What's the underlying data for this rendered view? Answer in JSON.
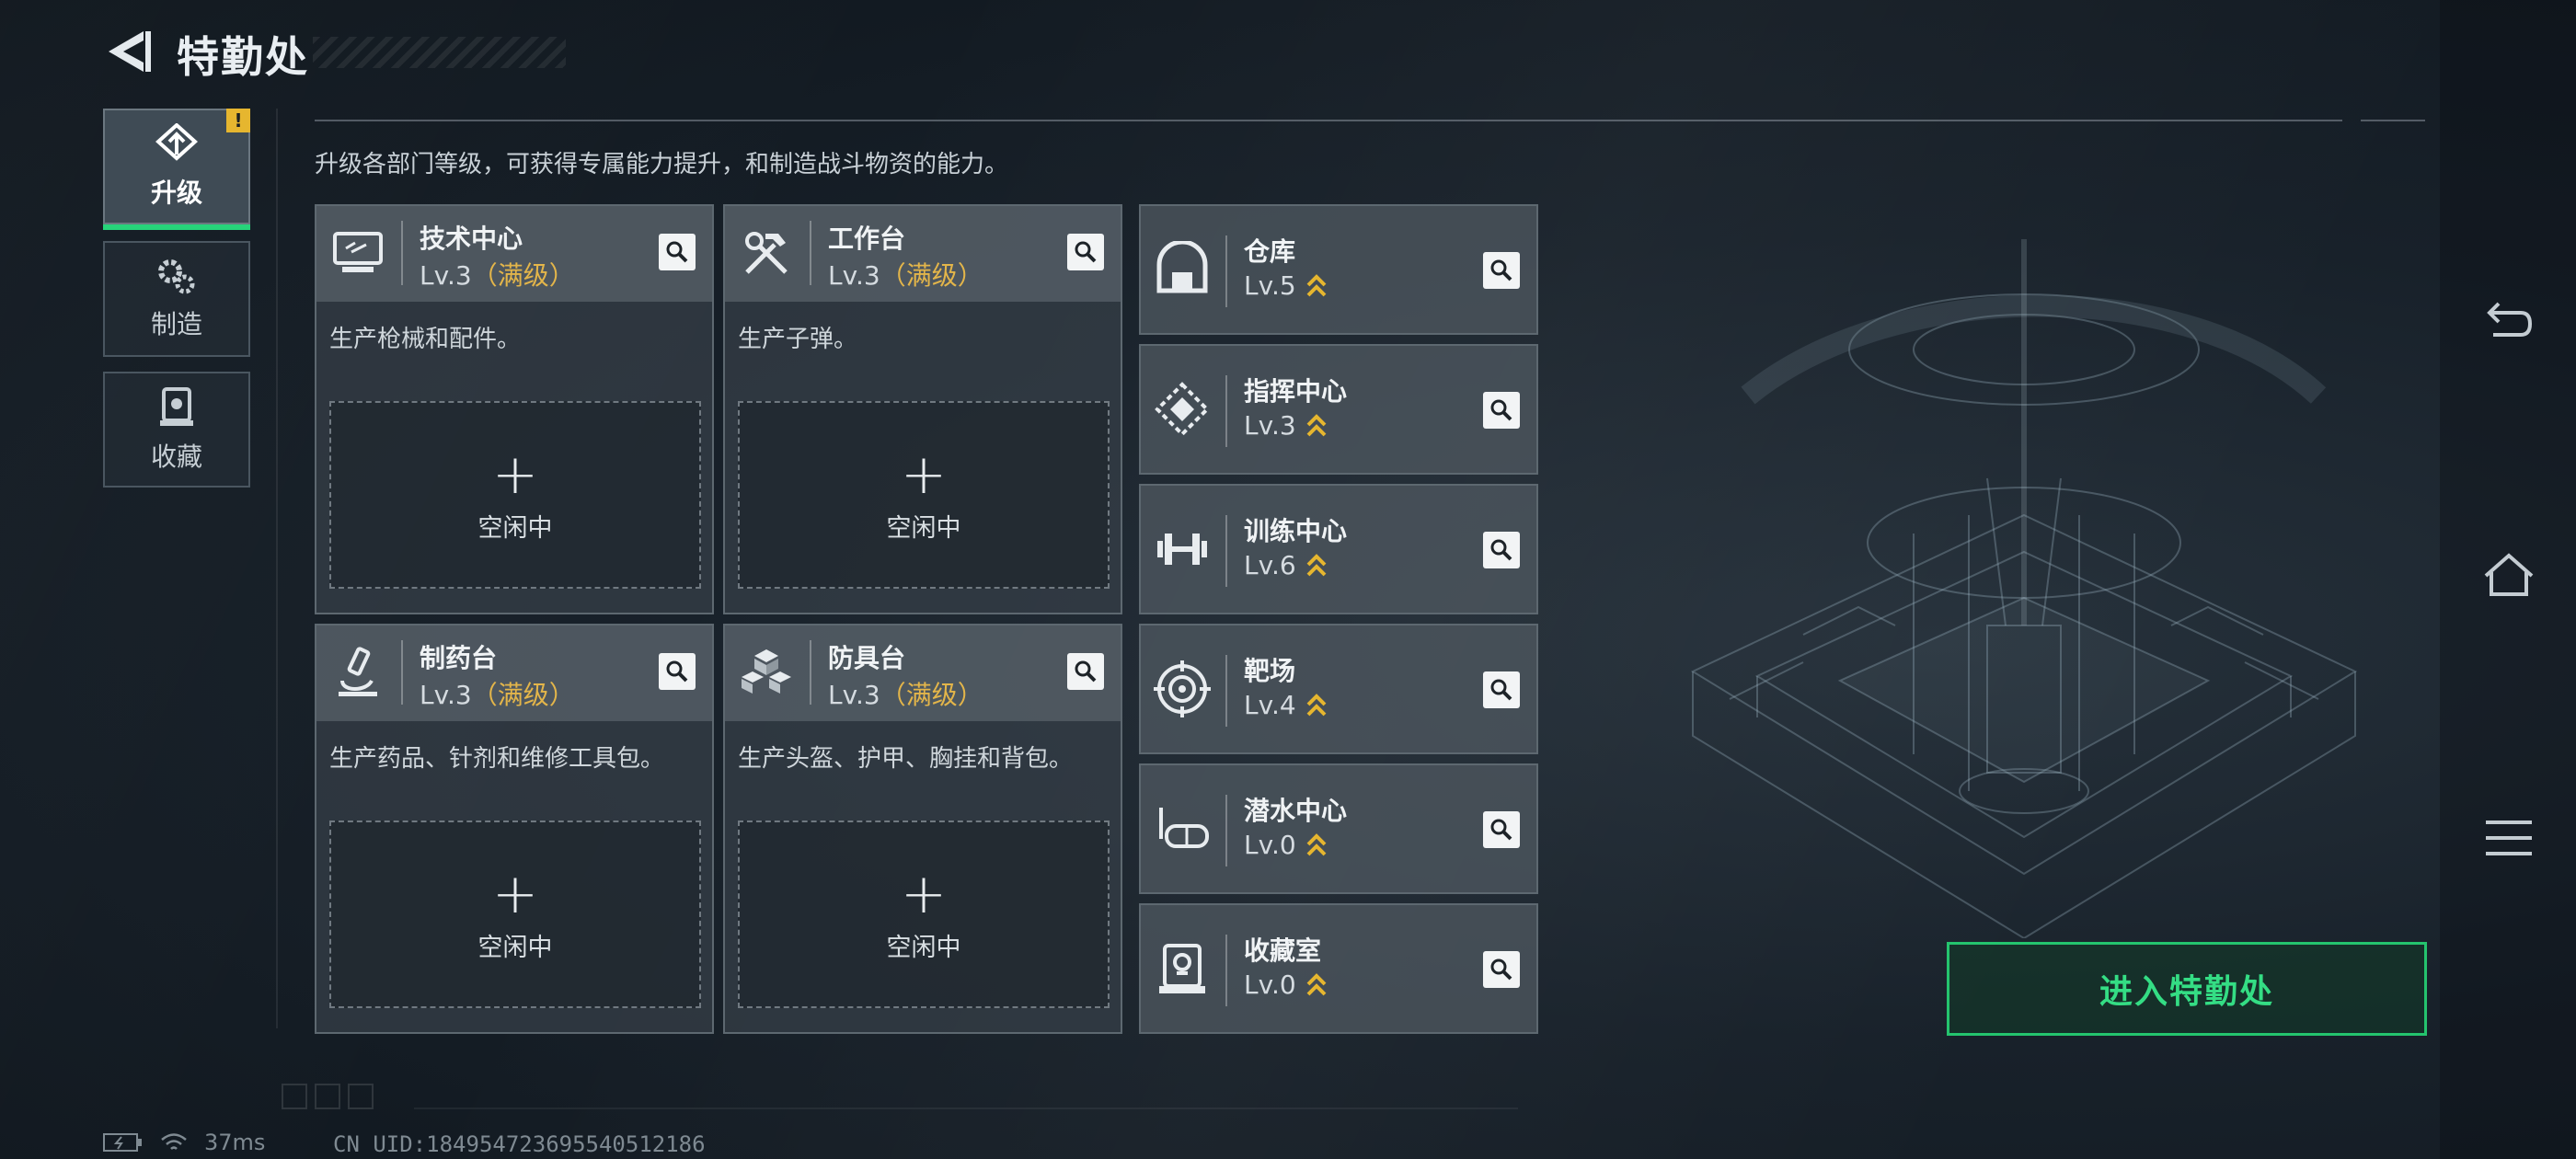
{
  "header": {
    "title": "特勤处",
    "back_icon": "back-arrow-icon"
  },
  "nav": {
    "items": [
      {
        "label": "升级",
        "icon": "upgrade-icon",
        "active": true,
        "badge": "!"
      },
      {
        "label": "制造",
        "icon": "gears-icon",
        "active": false
      },
      {
        "label": "收藏",
        "icon": "collection-icon",
        "active": false
      }
    ]
  },
  "intro": "升级各部门等级，可获得专属能力提升，和制造战斗物资的能力。",
  "production_cards": [
    {
      "name": "技术中心",
      "level": "Lv.3",
      "max": "（满级）",
      "desc": "生产枪械和配件。",
      "slot_plus": "+",
      "slot_text": "空闲中",
      "icon": "computer-icon"
    },
    {
      "name": "工作台",
      "level": "Lv.3",
      "max": "（满级）",
      "desc": "生产子弹。",
      "slot_plus": "+",
      "slot_text": "空闲中",
      "icon": "tools-icon"
    },
    {
      "name": "制药台",
      "level": "Lv.3",
      "max": "（满级）",
      "desc": "生产药品、针剂和维修工具包。",
      "slot_plus": "+",
      "slot_text": "空闲中",
      "icon": "microscope-icon"
    },
    {
      "name": "防具台",
      "level": "Lv.3",
      "max": "（满级）",
      "desc": "生产头盔、护甲、胸挂和背包。",
      "slot_plus": "+",
      "slot_text": "空闲中",
      "icon": "boxes-icon"
    }
  ],
  "facilities": [
    {
      "name": "仓库",
      "level": "Lv.5",
      "icon": "warehouse-icon"
    },
    {
      "name": "指挥中心",
      "level": "Lv.3",
      "icon": "command-icon"
    },
    {
      "name": "训练中心",
      "level": "Lv.6",
      "icon": "dumbbell-icon"
    },
    {
      "name": "靶场",
      "level": "Lv.4",
      "icon": "target-icon"
    },
    {
      "name": "潜水中心",
      "level": "Lv.0",
      "icon": "diving-mask-icon"
    },
    {
      "name": "收藏室",
      "level": "Lv.0",
      "icon": "trophy-case-icon"
    }
  ],
  "enter_button": "进入特勤处",
  "status": {
    "ping": "37ms",
    "uid": "CN UID:18495472369554051218​6"
  },
  "colors": {
    "accent_green": "#27d47a",
    "max_gold": "#e3b54a",
    "upgrade_gold": "#e6b62f"
  }
}
